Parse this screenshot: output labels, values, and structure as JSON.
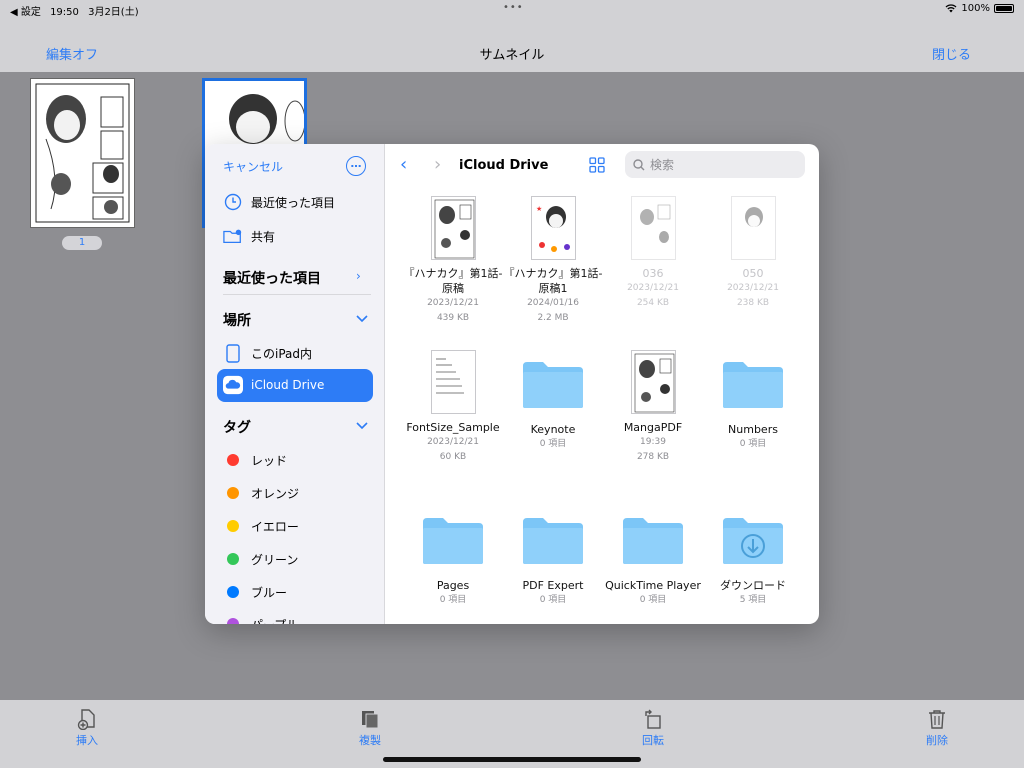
{
  "status_bar": {
    "back_app": "◀ 設定",
    "time": "19:50",
    "date": "3月2日(土)",
    "battery": "100%"
  },
  "nav": {
    "left": "編集オフ",
    "title": "サムネイル",
    "right": "閉じる"
  },
  "thumbnails": {
    "page_badge": "1"
  },
  "picker": {
    "cancel": "キャンセル",
    "more_label": "…",
    "quick": [
      {
        "label": "最近使った項目",
        "icon": "clock-icon"
      },
      {
        "label": "共有",
        "icon": "shared-folder-icon"
      }
    ],
    "sections": {
      "recent": "最近使った項目",
      "locations": "場所",
      "tags": "タグ"
    },
    "locations": [
      {
        "label": "このiPad内",
        "icon": "ipad-icon"
      },
      {
        "label": "iCloud Drive",
        "icon": "icloud-icon",
        "selected": true
      }
    ],
    "tags": [
      {
        "label": "レッド",
        "color": "#ff3b30"
      },
      {
        "label": "オレンジ",
        "color": "#ff9500"
      },
      {
        "label": "イエロー",
        "color": "#ffcc00"
      },
      {
        "label": "グリーン",
        "color": "#34c759"
      },
      {
        "label": "ブルー",
        "color": "#007aff"
      },
      {
        "label": "パープル",
        "color": "#af52de"
      }
    ],
    "location_title": "iCloud Drive",
    "search_placeholder": "検索",
    "items": [
      {
        "name": "『ハナカク』第1話-原稿",
        "date": "2023/12/21",
        "size": "439 KB",
        "kind": "doc",
        "dim": false
      },
      {
        "name": "『ハナカク』第1話-原稿1",
        "date": "2024/01/16",
        "size": "2.2 MB",
        "kind": "doc",
        "dim": false
      },
      {
        "name": "036",
        "date": "2023/12/21",
        "size": "254 KB",
        "kind": "doc",
        "dim": true
      },
      {
        "name": "050",
        "date": "2023/12/21",
        "size": "238 KB",
        "kind": "doc",
        "dim": true
      },
      {
        "name": "FontSize_Sample",
        "date": "2023/12/21",
        "size": "60 KB",
        "kind": "textdoc",
        "dim": false
      },
      {
        "name": "Keynote",
        "date": "0 項目",
        "size": "",
        "kind": "folder",
        "dim": false
      },
      {
        "name": "MangaPDF",
        "date": "19:39",
        "size": "278 KB",
        "kind": "doc",
        "dim": false
      },
      {
        "name": "Numbers",
        "date": "0 項目",
        "size": "",
        "kind": "folder",
        "dim": false
      },
      {
        "name": "Pages",
        "date": "0 項目",
        "size": "",
        "kind": "folder",
        "dim": false
      },
      {
        "name": "PDF Expert",
        "date": "0 項目",
        "size": "",
        "kind": "folder",
        "dim": false
      },
      {
        "name": "QuickTime Player",
        "date": "0 項目",
        "size": "",
        "kind": "folder",
        "dim": false
      },
      {
        "name": "ダウンロード",
        "date": "5 項目",
        "size": "",
        "kind": "download-folder",
        "dim": false
      }
    ]
  },
  "toolbar": [
    {
      "label": "挿入",
      "icon": "insert-page-icon"
    },
    {
      "label": "複製",
      "icon": "duplicate-icon"
    },
    {
      "label": "回転",
      "icon": "rotate-icon"
    },
    {
      "label": "削除",
      "icon": "trash-icon"
    }
  ],
  "colors": {
    "accent": "#2d7cf6",
    "folder": "#7cc6f7",
    "selection_border": "#1d6fe0"
  }
}
